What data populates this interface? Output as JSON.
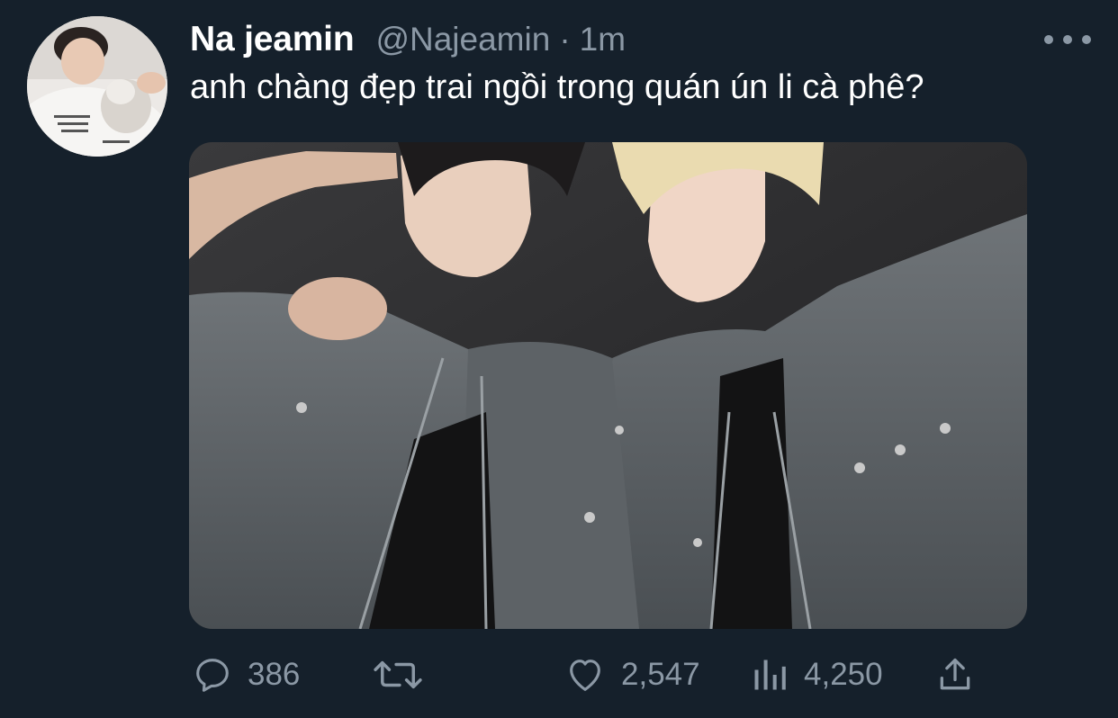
{
  "tweet": {
    "display_name": "Na jeamin",
    "handle": "@Najeamin",
    "separator": "·",
    "time": "1m",
    "text": "anh chàng đẹp trai ngồi trong quán ún li cà phê?"
  },
  "actions": {
    "replies": "386",
    "retweets": "",
    "likes": "2,547",
    "views": "4,250"
  },
  "icons": {
    "reply": "comment-icon",
    "retweet": "retweet-icon",
    "like": "heart-icon",
    "views": "analytics-icon",
    "share": "share-icon",
    "more": "more-icon"
  },
  "colors": {
    "background": "#15202b",
    "text_primary": "#ffffff",
    "text_secondary": "#8b98a5"
  }
}
